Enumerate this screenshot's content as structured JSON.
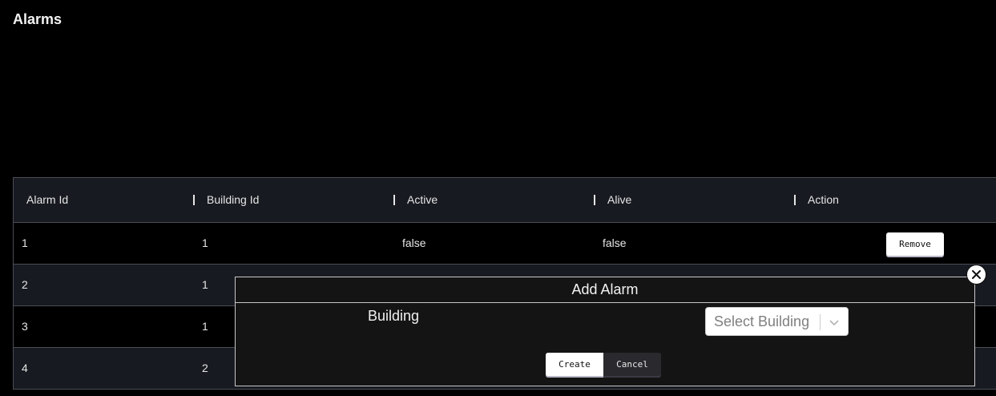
{
  "page": {
    "title": "Alarms"
  },
  "table": {
    "columns": [
      "Alarm Id",
      "Building Id",
      "Active",
      "Alive",
      "Action"
    ],
    "rows": [
      {
        "alarm_id": "1",
        "building_id": "1",
        "active": "false",
        "alive": "false",
        "action": "Remove"
      },
      {
        "alarm_id": "2",
        "building_id": "1"
      },
      {
        "alarm_id": "3",
        "building_id": "1"
      },
      {
        "alarm_id": "4",
        "building_id": "2"
      }
    ]
  },
  "modal": {
    "title": "Add Alarm",
    "field_label": "Building",
    "select_placeholder": "Select Building",
    "create_label": "Create",
    "cancel_label": "Cancel"
  },
  "icons": {
    "close": "close-icon",
    "dropdown": "chevron-down-icon"
  },
  "colors": {
    "background": "#000000",
    "header_bg": "#181a21",
    "modal_bg": "#141414"
  }
}
